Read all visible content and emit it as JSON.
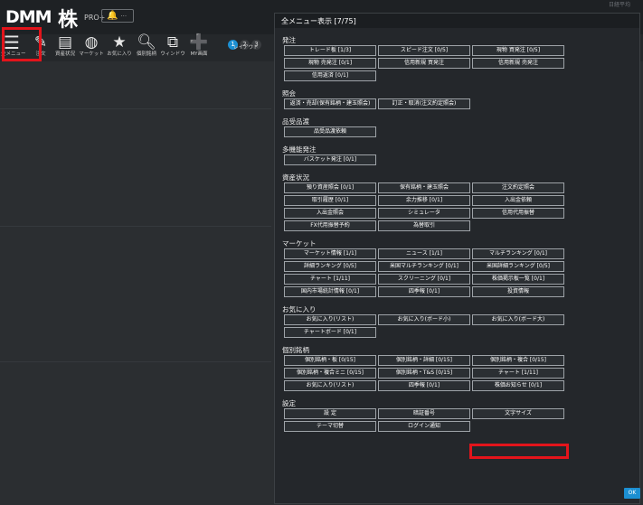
{
  "app": {
    "logo_text": "DMM",
    "logo_kabu": "株",
    "logo_pro": "PRO+",
    "bell_icon": "bell-icon",
    "top_right_text": "日経平均"
  },
  "toolbar": {
    "items": [
      {
        "label": "全メニュー",
        "icon": "menu-icon"
      },
      {
        "label": "注文",
        "icon": "order-icon"
      },
      {
        "label": "資産状況",
        "icon": "assets-icon"
      },
      {
        "label": "マーケット",
        "icon": "globe-icon"
      },
      {
        "label": "お気に入り",
        "icon": "star-icon"
      },
      {
        "label": "個別銘柄",
        "icon": "search-doc-icon"
      },
      {
        "label": "ウィンドウ",
        "icon": "window-icon"
      },
      {
        "label": "MY画面",
        "icon": "add-user-icon"
      }
    ],
    "pages": [
      "1",
      "2",
      "3"
    ],
    "layout_label": "レイアウト"
  },
  "modal": {
    "title": "全メニュー表示 [7/75]",
    "ok_label": "OK",
    "sections": [
      {
        "title": "発注",
        "rows": [
          [
            "トレード板 [1/3]",
            "スピード注文 [0/5]",
            "現物 買発注 [0/5]"
          ],
          [
            "現物 売発注 [0/1]",
            "信用新規 買発注",
            "信用新規 売発注"
          ],
          [
            "信用返済 [0/1]"
          ]
        ]
      },
      {
        "title": "照会",
        "rows": [
          [
            "返済・売却(保有銘柄・建玉照会)",
            "訂正・取消(注文約定照会)"
          ]
        ]
      },
      {
        "title": "品受品渡",
        "rows": [
          [
            "品受品渡依頼"
          ]
        ]
      },
      {
        "title": "多機能発注",
        "rows": [
          [
            "バスケット発注 [0/1]"
          ]
        ]
      },
      {
        "title": "資産状況",
        "rows": [
          [
            "預り資産照会 [0/1]",
            "保有銘柄・建玉照会",
            "注文約定照会"
          ],
          [
            "取引履歴 [0/1]",
            "余力推移 [0/1]",
            "入出金依頼"
          ],
          [
            "入出金照会",
            "シミュレータ",
            "信用代用振替"
          ],
          [
            "FX代用振替予約",
            "為替取引"
          ]
        ]
      },
      {
        "title": "マーケット",
        "rows": [
          [
            "マーケット情報 [1/1]",
            "ニュース [1/1]",
            "マルチランキング [0/1]"
          ],
          [
            "詳細ランキング [0/5]",
            "米国マルチランキング [0/1]",
            "米国詳細ランキング [0/5]"
          ],
          [
            "チャート [1/11]",
            "スクリーニング [0/1]",
            "株価掲示板一覧 [0/1]"
          ],
          [
            "国内市場統計情報 [0/1]",
            "四季報 [0/1]",
            "投資情報"
          ]
        ]
      },
      {
        "title": "お気に入り",
        "rows": [
          [
            "お気に入り(リスト)",
            "お気に入り(ボード小)",
            "お気に入り(ボード大)"
          ],
          [
            "チャートボード [0/1]"
          ]
        ]
      },
      {
        "title": "個別銘柄",
        "rows": [
          [
            "個別銘柄・板 [0/15]",
            "個別銘柄・詳細 [0/15]",
            "個別銘柄・複合 [0/15]"
          ],
          [
            "個別銘柄・複合ミニ [0/15]",
            "個別銘柄・T&S [0/15]",
            "チャート [1/11]"
          ],
          [
            "お気に入り(リスト)",
            "四季報 [0/1]",
            "株価お知らせ [0/1]"
          ]
        ]
      },
      {
        "title": "設定",
        "rows": [
          [
            "設 定",
            "暗証番号",
            "文字サイズ"
          ],
          [
            "テーマ切替",
            "ログイン通知"
          ]
        ]
      }
    ]
  }
}
